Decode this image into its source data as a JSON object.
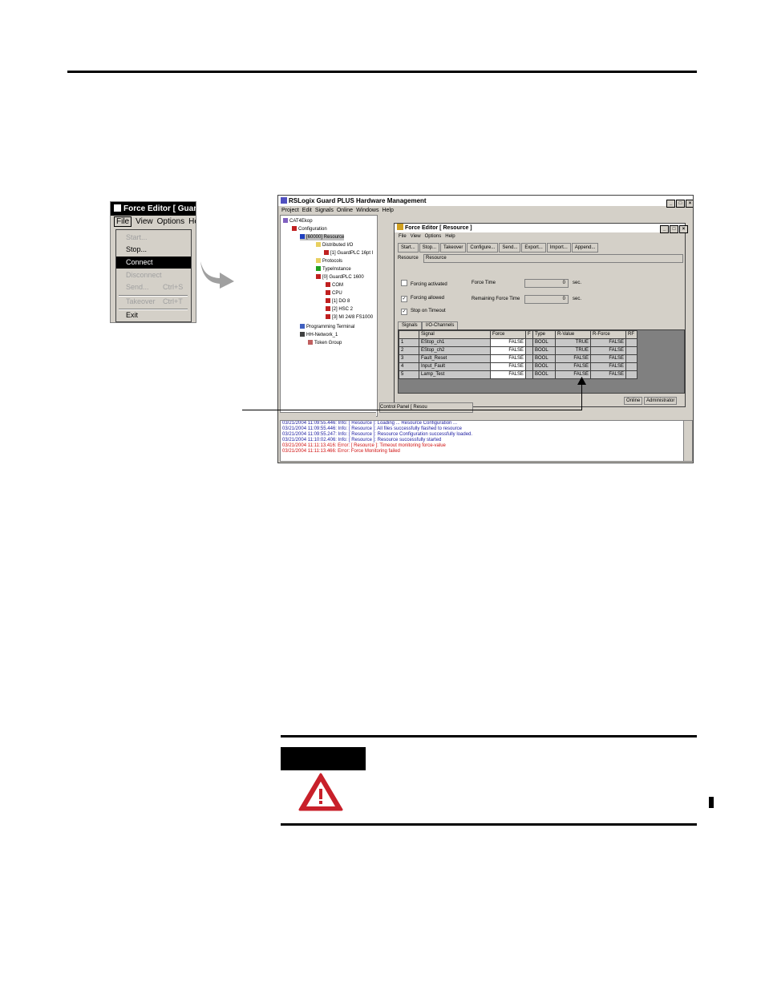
{
  "menu_shot": {
    "title": "Force Editor [ GuardP",
    "menubar": [
      "File",
      "View",
      "Options",
      "Help"
    ],
    "items": [
      {
        "label": "Start...",
        "shortcut": "",
        "state": "disabled"
      },
      {
        "label": "Stop...",
        "shortcut": "",
        "state": "normal"
      },
      {
        "label": "Connect",
        "shortcut": "",
        "state": "selected"
      },
      {
        "label": "Disconnect",
        "shortcut": "",
        "state": "disabled"
      },
      {
        "label": "Send...",
        "shortcut": "Ctrl+S",
        "state": "disabled"
      },
      {
        "label": "Takeover",
        "shortcut": "Ctrl+T",
        "state": "disabled"
      },
      {
        "label": "Exit",
        "shortcut": "",
        "state": "normal"
      }
    ]
  },
  "main_window": {
    "title": "RSLogix Guard PLUS Hardware Management",
    "menubar": [
      "Project",
      "Edit",
      "Signals",
      "Online",
      "Windows",
      "Help"
    ],
    "tree": [
      {
        "label": "CAT4Ekop",
        "icon": "project-icon"
      },
      {
        "label": "Configuration",
        "icon": "config-icon"
      },
      {
        "label": "[60000] Resource",
        "icon": "resource-icon",
        "selected": true
      },
      {
        "label": "Distributed I/O",
        "icon": "folder-icon"
      },
      {
        "label": "[1] GuardPLC 16pt I",
        "icon": "module-icon"
      },
      {
        "label": "Protocols",
        "icon": "folder-icon"
      },
      {
        "label": "TypeInstance",
        "icon": "type-icon"
      },
      {
        "label": "[0] GuardPLC 1600",
        "icon": "plc-icon"
      },
      {
        "label": "COM",
        "icon": "slot-icon"
      },
      {
        "label": "CPU",
        "icon": "slot-icon"
      },
      {
        "label": "[1] DO 8",
        "icon": "slot-icon"
      },
      {
        "label": "[2] HSC 2",
        "icon": "slot-icon"
      },
      {
        "label": "[3] MI 24/8 FS1000",
        "icon": "slot-icon"
      },
      {
        "label": "Programming Terminal",
        "icon": "terminal-icon"
      },
      {
        "label": "HH-Network_1",
        "icon": "network-icon"
      },
      {
        "label": "Token Group",
        "icon": "token-icon"
      }
    ],
    "log": [
      {
        "text": "03/21/2004 11:09:55.446: Info: [ Resource ]: Loading ... Resource Configuration ...",
        "color": "#1a1aa0"
      },
      {
        "text": "03/21/2004 11:09:55.446: Info: [ Resource ]: All files successfully flashed to resource",
        "color": "#1a1aa0"
      },
      {
        "text": "03/21/2004 11:09:55.247: Info: [ Resource ]: Resource Configuration successfully loaded.",
        "color": "#1a1aa0"
      },
      {
        "text": "03/21/2004 11:10:02.406: Info: [ Resource ]: Resource successfully started",
        "color": "#1a1aa0"
      },
      {
        "text": "03/21/2004 11:11:13.416: Error: [ Resource ]: Timeout monitoring force-value",
        "color": "#d01010"
      },
      {
        "text": "03/21/2004 11:11:13.466: Error: Force Monitoring failed",
        "color": "#d01010"
      }
    ],
    "control_panel": "Control Panel [ Resou"
  },
  "force_editor": {
    "title": "Force Editor [ Resource ]",
    "menubar": [
      "File",
      "View",
      "Options",
      "Help"
    ],
    "toolbar": [
      "Start...",
      "Stop...",
      "Takeover",
      "Configure...",
      "Send...",
      "Export...",
      "Import...",
      "Append..."
    ],
    "resource_label": "Resource",
    "resource_value": "Resource",
    "checks": [
      {
        "label": "Forcing activated",
        "checked": false
      },
      {
        "label": "Forcing allowed",
        "checked": true
      },
      {
        "label": "Stop on Timeout",
        "checked": true
      }
    ],
    "force_time_label": "Force Time",
    "force_time_value": "0",
    "remaining_label": "Remaining Force Time",
    "remaining_value": "0",
    "unit": "sec.",
    "tabs": [
      "Signals",
      "I/O-Channels"
    ],
    "columns": [
      "",
      "Signal",
      "Force",
      "F",
      "Type",
      "R-Value",
      "R-Force",
      "RF"
    ],
    "rows": [
      [
        "1",
        "EStop_ch1",
        "FALSE",
        "",
        "BOOL",
        "TRUE",
        "FALSE",
        ""
      ],
      [
        "2",
        "EStop_ch2",
        "FALSE",
        "",
        "BOOL",
        "TRUE",
        "FALSE",
        ""
      ],
      [
        "3",
        "Fault_Reset",
        "FALSE",
        "",
        "BOOL",
        "FALSE",
        "FALSE",
        ""
      ],
      [
        "4",
        "Input_Fault",
        "FALSE",
        "",
        "BOOL",
        "FALSE",
        "FALSE",
        ""
      ],
      [
        "5",
        "Lamp_Test",
        "FALSE",
        "",
        "BOOL",
        "FALSE",
        "FALSE",
        ""
      ]
    ],
    "status": [
      "Online",
      "Administrator"
    ]
  }
}
